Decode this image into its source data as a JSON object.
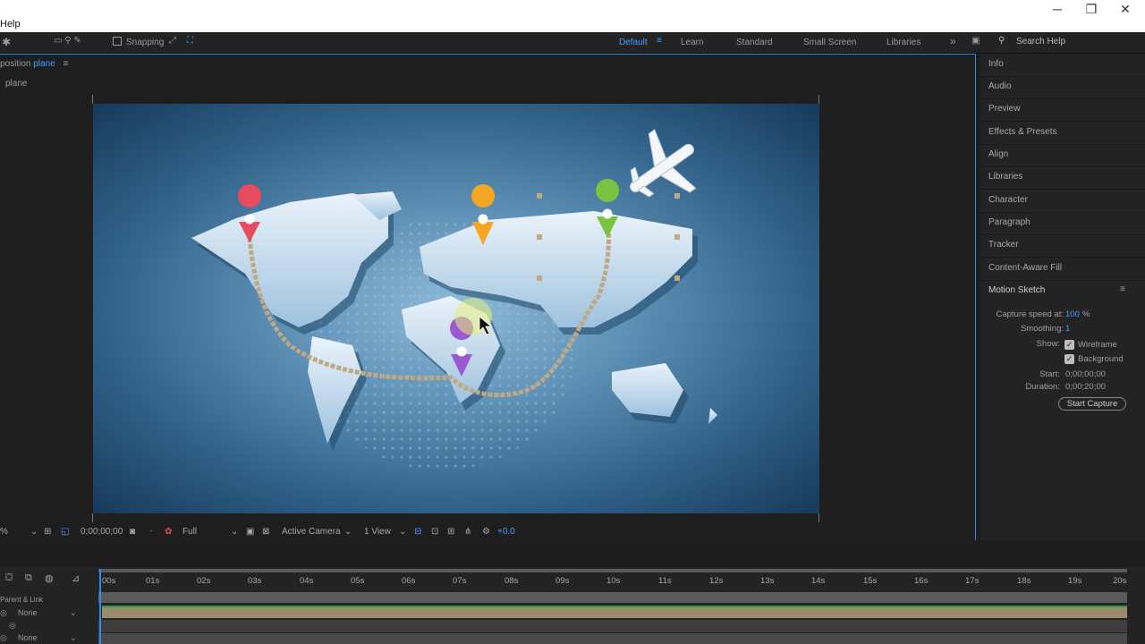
{
  "window": {
    "menu_help": "Help",
    "minimize": "─",
    "restore": "❐",
    "close": "✕"
  },
  "toolbar": {
    "snapping_label": "Snapping",
    "workspaces": [
      "Default",
      "Learn",
      "Standard",
      "Small Screen",
      "Libraries"
    ],
    "active_workspace": "Default",
    "search_placeholder": "Search Help"
  },
  "composition": {
    "tab_prefix": "position",
    "tab_name": "plane",
    "breadcrumb": "plane"
  },
  "viewer_footer": {
    "zoom": "%",
    "timecode": "0;00;00;00",
    "resolution": "Full",
    "camera": "Active Camera",
    "views": "1 View",
    "exposure": "+0.0"
  },
  "right_panel": {
    "items": [
      "Info",
      "Audio",
      "Preview",
      "Effects & Presets",
      "Align",
      "Libraries",
      "Character",
      "Paragraph",
      "Tracker",
      "Content-Aware Fill"
    ],
    "motion_sketch": {
      "title": "Motion Sketch",
      "capture_speed_label": "Capture speed at:",
      "capture_speed_value": "100",
      "capture_speed_unit": "%",
      "smoothing_label": "Smoothing:",
      "smoothing_value": "1",
      "show_label": "Show:",
      "wireframe_label": "Wireframe",
      "wireframe_checked": true,
      "background_label": "Background",
      "background_checked": true,
      "start_label": "Start:",
      "start_value": "0;00;00;00",
      "duration_label": "Duration:",
      "duration_value": "0;00;20;00",
      "start_capture": "Start Capture"
    }
  },
  "timeline": {
    "ticks": [
      "00s",
      "01s",
      "02s",
      "03s",
      "04s",
      "05s",
      "06s",
      "07s",
      "08s",
      "09s",
      "10s",
      "11s",
      "12s",
      "13s",
      "14s",
      "15s",
      "16s",
      "17s",
      "18s",
      "19s",
      "20s"
    ],
    "parent_link_label": "Parent & Link",
    "parent_none_1": "None",
    "parent_none_2": "None"
  },
  "colors": {
    "accent": "#4a9eff",
    "panel_border": "#2d8ceb",
    "pin_red": "#e84a5f",
    "pin_orange": "#f5a623",
    "pin_green": "#7cc242",
    "pin_purple": "#9b59d0",
    "path": "#c0a884"
  }
}
